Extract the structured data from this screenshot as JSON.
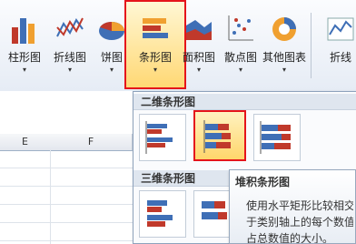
{
  "ribbon": {
    "buttons": [
      {
        "id": "column",
        "label": "柱形图",
        "icon": "column-chart-icon"
      },
      {
        "id": "line",
        "label": "折线图",
        "icon": "line-chart-icon"
      },
      {
        "id": "pie",
        "label": "饼图",
        "icon": "pie-chart-icon"
      },
      {
        "id": "bar",
        "label": "条形图",
        "icon": "bar-chart-icon"
      },
      {
        "id": "area",
        "label": "面积图",
        "icon": "area-chart-icon"
      },
      {
        "id": "scatter",
        "label": "散点图",
        "icon": "scatter-chart-icon"
      },
      {
        "id": "other",
        "label": "其他图表",
        "icon": "other-chart-icon"
      },
      {
        "id": "sparkline",
        "label": "折线",
        "icon": "sparkline-icon"
      }
    ],
    "arrow": "▾"
  },
  "sheet": {
    "columns": [
      "E",
      "F"
    ]
  },
  "dropdown": {
    "section_2d": "二维条形图",
    "section_3d": "三维条形图"
  },
  "tooltip": {
    "title": "堆积条形图",
    "line1": "使用水平矩形比较相交",
    "line2": "于类别轴上的每个数值",
    "line3": "占总数值的大小。"
  },
  "colors": {
    "highlight": "#e5141b",
    "blue": "#3f6fb6",
    "red": "#c0392b",
    "orange": "#f0a030",
    "green": "#6aa84f"
  }
}
